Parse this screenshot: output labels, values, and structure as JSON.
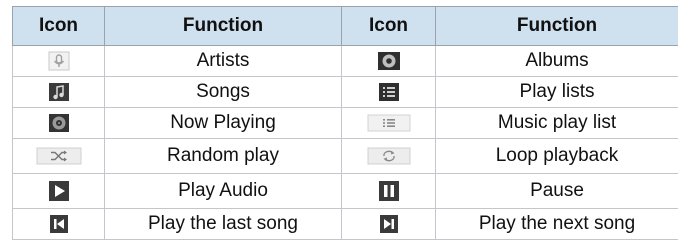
{
  "table": {
    "headers": [
      "Icon",
      "Function",
      "Icon",
      "Function"
    ],
    "rows": [
      {
        "left_icon": "microphone-icon",
        "left_label": "Artists",
        "right_icon": "album-disc-icon",
        "right_label": "Albums"
      },
      {
        "left_icon": "music-note-icon",
        "left_label": "Songs",
        "right_icon": "playlist-icon",
        "right_label": "Play lists"
      },
      {
        "left_icon": "now-playing-icon",
        "left_label": "Now Playing",
        "right_icon": "music-playlist-icon",
        "right_label": "Music play list"
      },
      {
        "left_icon": "shuffle-icon",
        "left_label": "Random play",
        "right_icon": "loop-icon",
        "right_label": "Loop playback"
      },
      {
        "left_icon": "play-icon",
        "left_label": "Play Audio",
        "right_icon": "pause-icon",
        "right_label": "Pause"
      },
      {
        "left_icon": "previous-track-icon",
        "left_label": "Play the last song",
        "right_icon": "next-track-icon",
        "right_label": "Play the next song"
      }
    ]
  }
}
